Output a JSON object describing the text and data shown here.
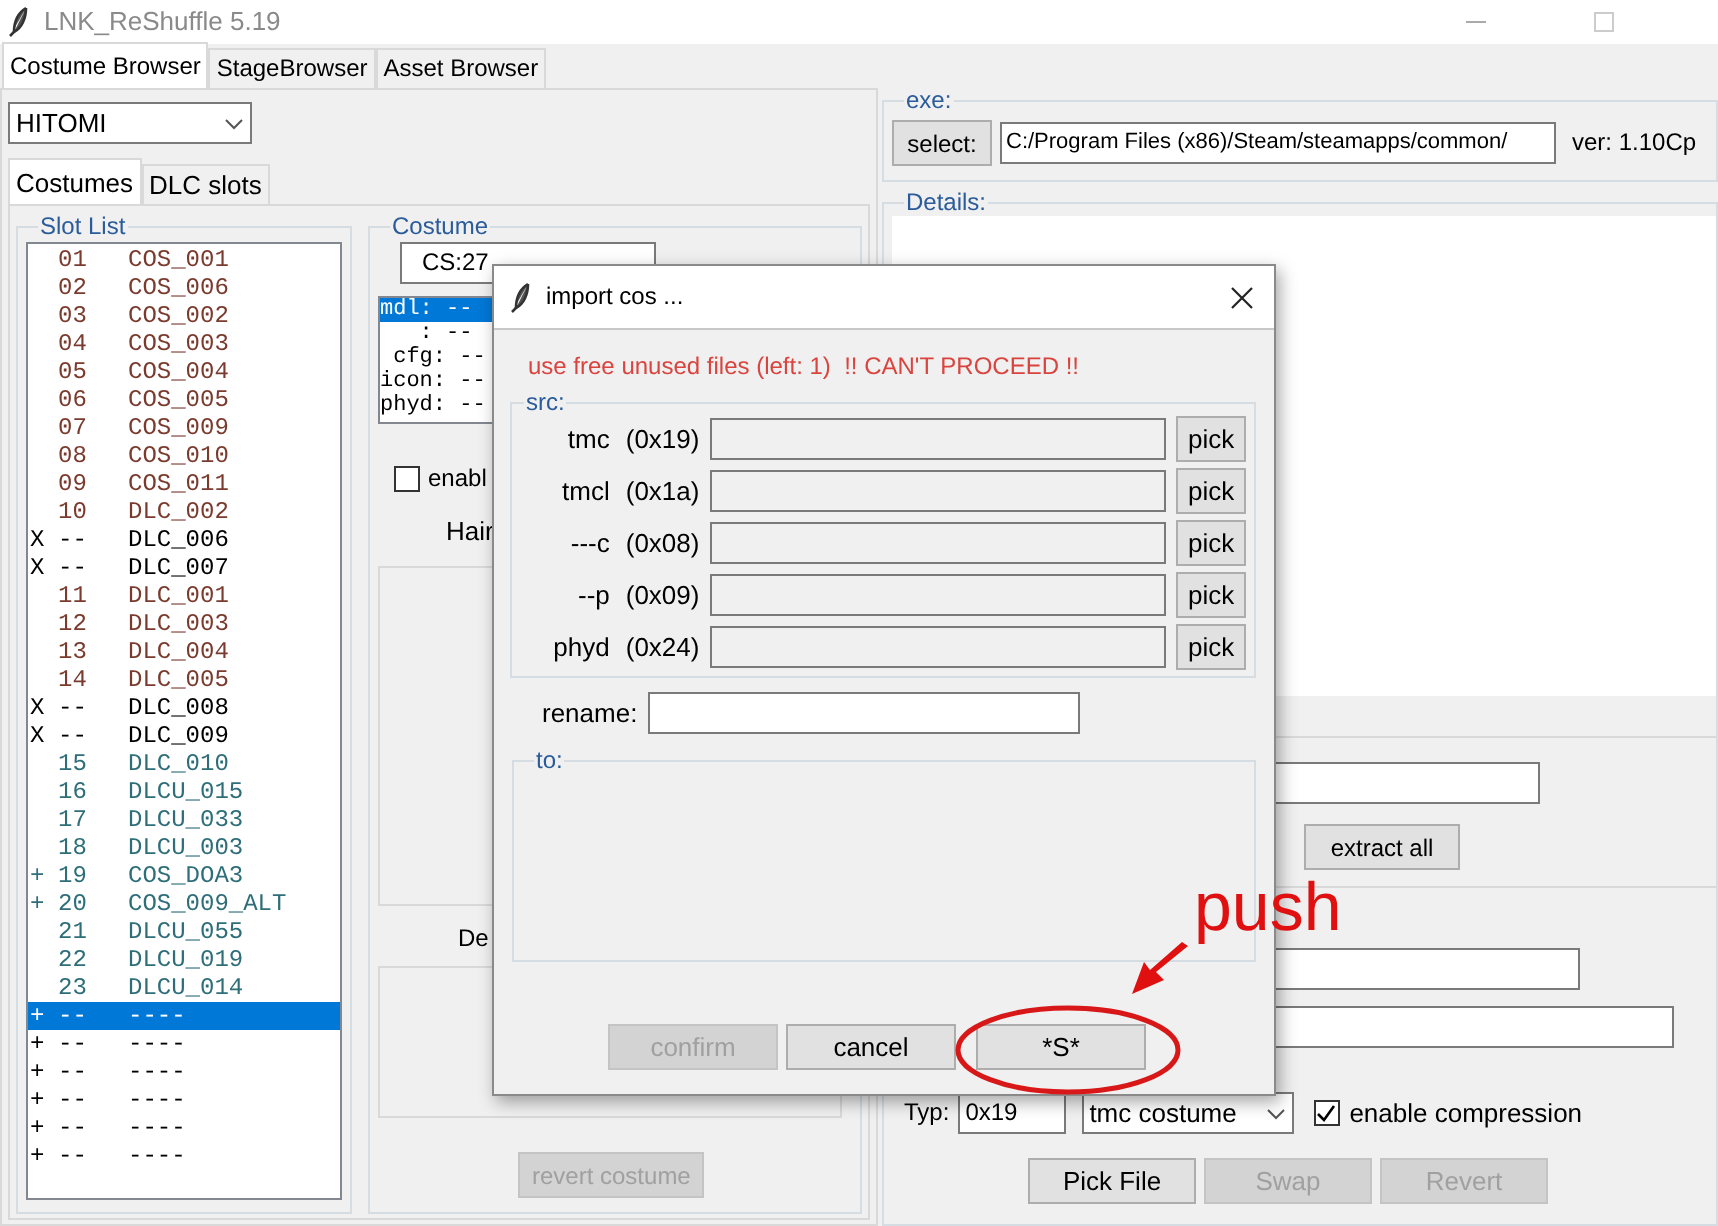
{
  "window": {
    "title": "LNK_ReShuffle 5.19"
  },
  "main_tabs": [
    {
      "label": "Costume Browser",
      "selected": true
    },
    {
      "label": "StageBrowser",
      "selected": false
    },
    {
      "label": "Asset Browser",
      "selected": false
    }
  ],
  "character_select": {
    "value": "HITOMI"
  },
  "sub_tabs": [
    {
      "label": "Costumes",
      "selected": true
    },
    {
      "label": "DLC slots",
      "selected": false
    }
  ],
  "slot_list": {
    "title": "Slot List",
    "items": [
      {
        "number": "01",
        "name": "COS_001",
        "color": "#7a3b2e",
        "selected": false
      },
      {
        "number": "02",
        "name": "COS_006",
        "color": "#7a3b2e",
        "selected": false
      },
      {
        "number": "03",
        "name": "COS_002",
        "color": "#7a3b2e",
        "selected": false
      },
      {
        "number": "04",
        "name": "COS_003",
        "color": "#7a3b2e",
        "selected": false
      },
      {
        "number": "05",
        "name": "COS_004",
        "color": "#7a3b2e",
        "selected": false
      },
      {
        "number": "06",
        "name": "COS_005",
        "color": "#7a3b2e",
        "selected": false
      },
      {
        "number": "07",
        "name": "COS_009",
        "color": "#7a3b2e",
        "selected": false
      },
      {
        "number": "08",
        "name": "COS_010",
        "color": "#7a3b2e",
        "selected": false
      },
      {
        "number": "09",
        "name": "COS_011",
        "color": "#7a3b2e",
        "selected": false
      },
      {
        "number": "10",
        "name": "DLC_002",
        "color": "#7a3b2e",
        "selected": false
      },
      {
        "mark": "X",
        "number": "--",
        "name": "DLC_006",
        "color": "#000000",
        "selected": false
      },
      {
        "mark": "X",
        "number": "--",
        "name": "DLC_007",
        "color": "#000000",
        "selected": false
      },
      {
        "number": "11",
        "name": "DLC_001",
        "color": "#7a3b2e",
        "selected": false
      },
      {
        "number": "12",
        "name": "DLC_003",
        "color": "#7a3b2e",
        "selected": false
      },
      {
        "number": "13",
        "name": "DLC_004",
        "color": "#7a3b2e",
        "selected": false
      },
      {
        "number": "14",
        "name": "DLC_005",
        "color": "#7a3b2e",
        "selected": false
      },
      {
        "mark": "X",
        "number": "--",
        "name": "DLC_008",
        "color": "#000000",
        "selected": false
      },
      {
        "mark": "X",
        "number": "--",
        "name": "DLC_009",
        "color": "#000000",
        "selected": false
      },
      {
        "number": "15",
        "name": "DLC_010",
        "color": "#2e6e78",
        "selected": false
      },
      {
        "number": "16",
        "name": "DLCU_015",
        "color": "#2e6e78",
        "selected": false
      },
      {
        "number": "17",
        "name": "DLCU_033",
        "color": "#2e6e78",
        "selected": false
      },
      {
        "number": "18",
        "name": "DLCU_003",
        "color": "#2e6e78",
        "selected": false
      },
      {
        "mark": "+",
        "number": "19",
        "name": "COS_DOA3",
        "color": "#2e6e78",
        "selected": false
      },
      {
        "mark": "+",
        "number": "20",
        "name": "COS_009_ALT",
        "color": "#2e6e78",
        "selected": false
      },
      {
        "number": "21",
        "name": "DLCU_055",
        "color": "#2e6e78",
        "selected": false
      },
      {
        "number": "22",
        "name": "DLCU_019",
        "color": "#2e6e78",
        "selected": false
      },
      {
        "number": "23",
        "name": "DLCU_014",
        "color": "#2e6e78",
        "selected": false
      },
      {
        "mark": "+",
        "number": "--",
        "name": "----",
        "selected": true
      },
      {
        "mark": "+",
        "number": "--",
        "name": "----",
        "color": "#000000",
        "selected": false
      },
      {
        "mark": "+",
        "number": "--",
        "name": "----",
        "color": "#000000",
        "selected": false
      },
      {
        "mark": "+",
        "number": "--",
        "name": "----",
        "color": "#000000",
        "selected": false
      },
      {
        "mark": "+",
        "number": "--",
        "name": "----",
        "color": "#000000",
        "selected": false
      },
      {
        "mark": "+",
        "number": "--",
        "name": "----",
        "color": "#000000",
        "selected": false
      }
    ]
  },
  "costume": {
    "title": "Costume",
    "slot_field": "CS:27",
    "files": [
      {
        "text": "mdl: --",
        "selected": true
      },
      {
        "text": "   : --",
        "selected": false
      },
      {
        "text": " cfg: --",
        "selected": false
      },
      {
        "text": "icon: --",
        "selected": false
      },
      {
        "text": "phyd: --",
        "selected": false
      }
    ],
    "enable_checkbox": {
      "label": "enabl",
      "checked": false
    },
    "hair_label": "Hair",
    "de_label": "De",
    "revert_button": {
      "label": "revert costume",
      "disabled": true
    }
  },
  "exe": {
    "title": "exe:",
    "select_button": "select:",
    "path": "C:/Program Files (x86)/Steam/steamapps/common/",
    "version": "ver: 1.10Cp"
  },
  "details": {
    "title": "Details:",
    "extract_all_button": "extract all",
    "type_label": "Typ:",
    "type_value": "0x19",
    "type_select": "tmc costume",
    "compression": {
      "label": "enable compression",
      "checked": true
    },
    "buttons": [
      {
        "label": "Pick File",
        "disabled": false
      },
      {
        "label": "Swap",
        "disabled": true
      },
      {
        "label": "Revert",
        "disabled": true
      }
    ]
  },
  "dialog": {
    "title": "import cos ...",
    "warning": "use free unused files (left: 1)  !! CAN'T PROCEED !!",
    "src_title": "src:",
    "sources": [
      {
        "name": "tmc",
        "code": "(0x19)",
        "button": "pick"
      },
      {
        "name": "tmcl",
        "code": "(0x1a)",
        "button": "pick"
      },
      {
        "name": "---c",
        "code": "(0x08)",
        "button": "pick"
      },
      {
        "name": "--p",
        "code": "(0x09)",
        "button": "pick"
      },
      {
        "name": "phyd",
        "code": "(0x24)",
        "button": "pick"
      }
    ],
    "rename_label": "rename:",
    "to_title": "to:",
    "buttons": [
      {
        "label": "confirm",
        "disabled": true
      },
      {
        "label": "cancel",
        "disabled": false
      },
      {
        "label": "*S*",
        "disabled": false
      }
    ]
  },
  "annotation": {
    "text": "push"
  }
}
